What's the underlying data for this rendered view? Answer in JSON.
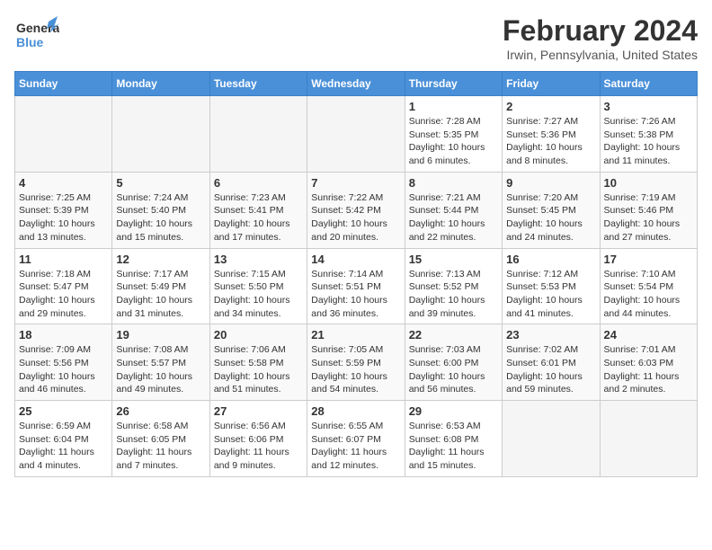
{
  "header": {
    "logo_line1": "General",
    "logo_line2": "Blue",
    "month_year": "February 2024",
    "location": "Irwin, Pennsylvania, United States"
  },
  "weekdays": [
    "Sunday",
    "Monday",
    "Tuesday",
    "Wednesday",
    "Thursday",
    "Friday",
    "Saturday"
  ],
  "weeks": [
    [
      {
        "day": "",
        "info": ""
      },
      {
        "day": "",
        "info": ""
      },
      {
        "day": "",
        "info": ""
      },
      {
        "day": "",
        "info": ""
      },
      {
        "day": "1",
        "info": "Sunrise: 7:28 AM\nSunset: 5:35 PM\nDaylight: 10 hours\nand 6 minutes."
      },
      {
        "day": "2",
        "info": "Sunrise: 7:27 AM\nSunset: 5:36 PM\nDaylight: 10 hours\nand 8 minutes."
      },
      {
        "day": "3",
        "info": "Sunrise: 7:26 AM\nSunset: 5:38 PM\nDaylight: 10 hours\nand 11 minutes."
      }
    ],
    [
      {
        "day": "4",
        "info": "Sunrise: 7:25 AM\nSunset: 5:39 PM\nDaylight: 10 hours\nand 13 minutes."
      },
      {
        "day": "5",
        "info": "Sunrise: 7:24 AM\nSunset: 5:40 PM\nDaylight: 10 hours\nand 15 minutes."
      },
      {
        "day": "6",
        "info": "Sunrise: 7:23 AM\nSunset: 5:41 PM\nDaylight: 10 hours\nand 17 minutes."
      },
      {
        "day": "7",
        "info": "Sunrise: 7:22 AM\nSunset: 5:42 PM\nDaylight: 10 hours\nand 20 minutes."
      },
      {
        "day": "8",
        "info": "Sunrise: 7:21 AM\nSunset: 5:44 PM\nDaylight: 10 hours\nand 22 minutes."
      },
      {
        "day": "9",
        "info": "Sunrise: 7:20 AM\nSunset: 5:45 PM\nDaylight: 10 hours\nand 24 minutes."
      },
      {
        "day": "10",
        "info": "Sunrise: 7:19 AM\nSunset: 5:46 PM\nDaylight: 10 hours\nand 27 minutes."
      }
    ],
    [
      {
        "day": "11",
        "info": "Sunrise: 7:18 AM\nSunset: 5:47 PM\nDaylight: 10 hours\nand 29 minutes."
      },
      {
        "day": "12",
        "info": "Sunrise: 7:17 AM\nSunset: 5:49 PM\nDaylight: 10 hours\nand 31 minutes."
      },
      {
        "day": "13",
        "info": "Sunrise: 7:15 AM\nSunset: 5:50 PM\nDaylight: 10 hours\nand 34 minutes."
      },
      {
        "day": "14",
        "info": "Sunrise: 7:14 AM\nSunset: 5:51 PM\nDaylight: 10 hours\nand 36 minutes."
      },
      {
        "day": "15",
        "info": "Sunrise: 7:13 AM\nSunset: 5:52 PM\nDaylight: 10 hours\nand 39 minutes."
      },
      {
        "day": "16",
        "info": "Sunrise: 7:12 AM\nSunset: 5:53 PM\nDaylight: 10 hours\nand 41 minutes."
      },
      {
        "day": "17",
        "info": "Sunrise: 7:10 AM\nSunset: 5:54 PM\nDaylight: 10 hours\nand 44 minutes."
      }
    ],
    [
      {
        "day": "18",
        "info": "Sunrise: 7:09 AM\nSunset: 5:56 PM\nDaylight: 10 hours\nand 46 minutes."
      },
      {
        "day": "19",
        "info": "Sunrise: 7:08 AM\nSunset: 5:57 PM\nDaylight: 10 hours\nand 49 minutes."
      },
      {
        "day": "20",
        "info": "Sunrise: 7:06 AM\nSunset: 5:58 PM\nDaylight: 10 hours\nand 51 minutes."
      },
      {
        "day": "21",
        "info": "Sunrise: 7:05 AM\nSunset: 5:59 PM\nDaylight: 10 hours\nand 54 minutes."
      },
      {
        "day": "22",
        "info": "Sunrise: 7:03 AM\nSunset: 6:00 PM\nDaylight: 10 hours\nand 56 minutes."
      },
      {
        "day": "23",
        "info": "Sunrise: 7:02 AM\nSunset: 6:01 PM\nDaylight: 10 hours\nand 59 minutes."
      },
      {
        "day": "24",
        "info": "Sunrise: 7:01 AM\nSunset: 6:03 PM\nDaylight: 11 hours\nand 2 minutes."
      }
    ],
    [
      {
        "day": "25",
        "info": "Sunrise: 6:59 AM\nSunset: 6:04 PM\nDaylight: 11 hours\nand 4 minutes."
      },
      {
        "day": "26",
        "info": "Sunrise: 6:58 AM\nSunset: 6:05 PM\nDaylight: 11 hours\nand 7 minutes."
      },
      {
        "day": "27",
        "info": "Sunrise: 6:56 AM\nSunset: 6:06 PM\nDaylight: 11 hours\nand 9 minutes."
      },
      {
        "day": "28",
        "info": "Sunrise: 6:55 AM\nSunset: 6:07 PM\nDaylight: 11 hours\nand 12 minutes."
      },
      {
        "day": "29",
        "info": "Sunrise: 6:53 AM\nSunset: 6:08 PM\nDaylight: 11 hours\nand 15 minutes."
      },
      {
        "day": "",
        "info": ""
      },
      {
        "day": "",
        "info": ""
      }
    ]
  ]
}
